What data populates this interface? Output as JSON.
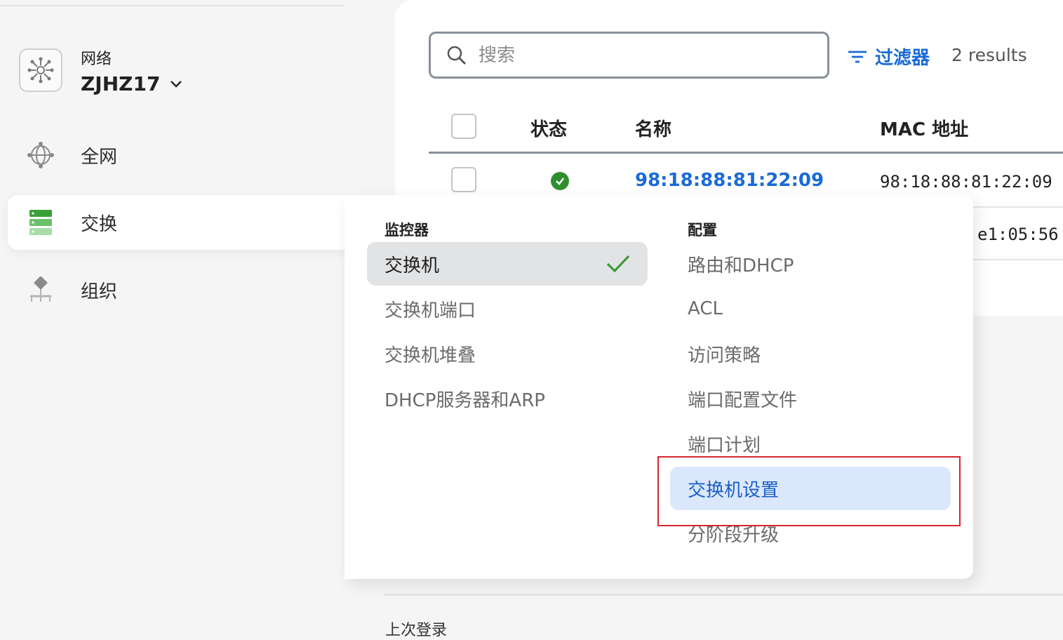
{
  "sidebar": {
    "network_label": "网络",
    "network_name": "ZJHZ17",
    "items": [
      {
        "label": "全网",
        "icon": "globe-icon"
      },
      {
        "label": "交换",
        "icon": "switch-stack-icon",
        "active": true
      },
      {
        "label": "组织",
        "icon": "organization-icon"
      }
    ]
  },
  "toolbar": {
    "search_placeholder": "搜索",
    "filter_label": "过滤器",
    "results_text": "2 results"
  },
  "table": {
    "headers": {
      "status": "状态",
      "name": "名称",
      "mac": "MAC 地址"
    },
    "rows": [
      {
        "status": "online",
        "name": "98:18:88:81:22:09",
        "mac": "98:18:88:81:22:09"
      },
      {
        "mac_partial": "e1:05:56"
      }
    ]
  },
  "menu": {
    "monitor_title": "监控器",
    "monitor_items": [
      "交换机",
      "交换机端口",
      "交换机堆叠",
      "DHCP服务器和ARP"
    ],
    "config_title": "配置",
    "config_items": [
      "路由和DHCP",
      "ACL",
      "访问策略",
      "端口配置文件",
      "端口计划",
      "交换机设置",
      "分阶段升级"
    ]
  },
  "footer": {
    "partial_text": "上次登录"
  },
  "colors": {
    "accent": "#1a6bd6",
    "status_ok": "#2f8f2f",
    "highlight_border": "#d6262e",
    "hover_bg": "#dbe7fb",
    "selected_bg": "#e2e3e5"
  }
}
